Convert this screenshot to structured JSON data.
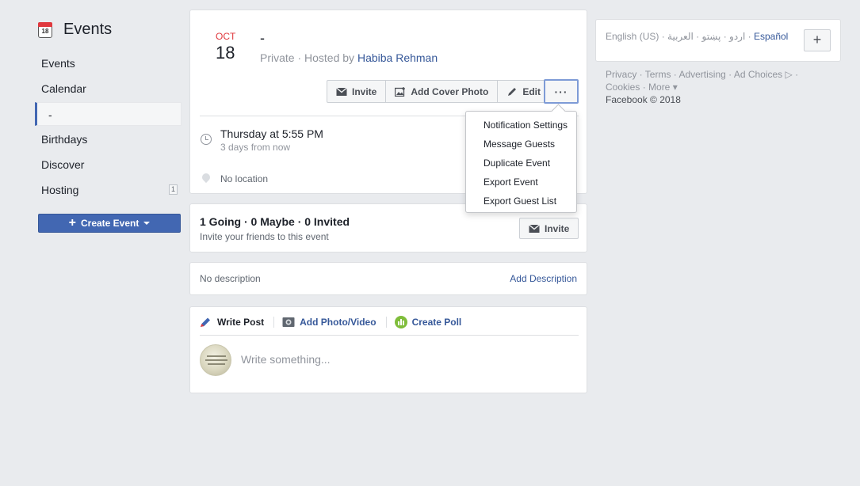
{
  "nav": {
    "title": "Events",
    "calendar_icon_day": "18",
    "items": [
      {
        "label": "Events"
      },
      {
        "label": "Calendar"
      },
      {
        "label": "-"
      },
      {
        "label": "Birthdays"
      },
      {
        "label": "Discover"
      },
      {
        "label": "Hosting",
        "badge": "1"
      }
    ],
    "create_button": "Create Event"
  },
  "event": {
    "month": "OCT",
    "day": "18",
    "name": "-",
    "privacy": "Private · Hosted by",
    "host": "Habiba Rehman",
    "actions": {
      "invite": "Invite",
      "add_cover": "Add Cover Photo",
      "edit": "Edit",
      "more": "···"
    },
    "time_main": "Thursday at 5:55 PM",
    "time_sub": "3 days from now",
    "location": "No location"
  },
  "guests": {
    "counts": "1 Going · 0 Maybe · 0 Invited",
    "sub": "Invite your friends to this event",
    "invite": "Invite"
  },
  "description": {
    "none": "No description",
    "add": "Add Description"
  },
  "post": {
    "tabs": [
      "Write Post",
      "Add Photo/Video",
      "Create Poll"
    ],
    "placeholder": "Write something..."
  },
  "dropdown": {
    "items": [
      "Notification Settings",
      "Message Guests",
      "Duplicate Event",
      "Export Event",
      "Export Guest List"
    ]
  },
  "languages": {
    "current": "English (US) ·",
    "others": "اردو · پښتو · العربية ·",
    "link": "Español",
    "add": "+"
  },
  "footer": {
    "line1": "Privacy · Terms · Advertising · Ad Choices ▷ ·",
    "line2": "Cookies · More ▾",
    "copyright": "Facebook © 2018"
  },
  "colors": {
    "brand_blue": "#4267b2",
    "link_blue": "#365899",
    "date_red": "#e0393e",
    "background": "#e9ebee"
  }
}
